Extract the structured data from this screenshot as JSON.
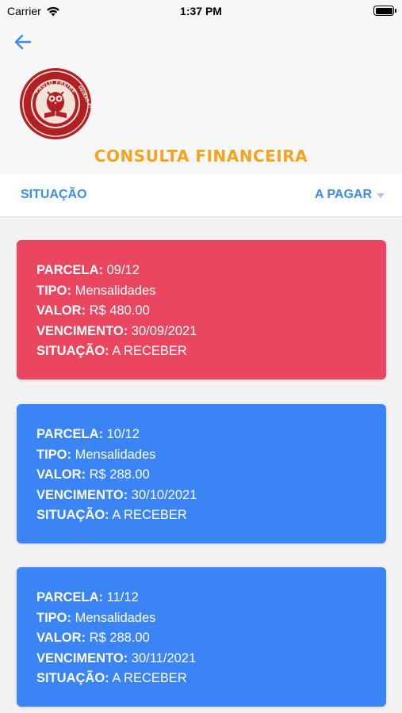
{
  "status_bar": {
    "carrier": "Carrier",
    "time": "1:37 PM",
    "wifi_icon": "wifi-icon",
    "battery_icon": "battery-icon"
  },
  "header": {
    "back_icon": "arrow-left-icon",
    "logo_text_top": "PAULO FREIRE",
    "logo_text_side": "OEIRAS-PI",
    "title": "CONSULTA FINANCEIRA"
  },
  "filter": {
    "label": "SITUAÇÃO",
    "selected": "A PAGAR"
  },
  "cards": [
    {
      "color": "#ea4660",
      "parcela_label": "PARCELA:",
      "parcela": "09/12",
      "tipo_label": "TIPO:",
      "tipo": "Mensalidades",
      "valor_label": "VALOR:",
      "valor": "R$ 480.00",
      "vencimento_label": "VENCIMENTO:",
      "vencimento": "30/09/2021",
      "situacao_label": "SITUAÇÃO:",
      "situacao": "A RECEBER"
    },
    {
      "color": "#3a84f5",
      "parcela_label": "PARCELA:",
      "parcela": "10/12",
      "tipo_label": "TIPO:",
      "tipo": "Mensalidades",
      "valor_label": "VALOR:",
      "valor": "R$ 288.00",
      "vencimento_label": "VENCIMENTO:",
      "vencimento": "30/10/2021",
      "situacao_label": "SITUAÇÃO:",
      "situacao": "A RECEBER"
    },
    {
      "color": "#3a84f5",
      "parcela_label": "PARCELA:",
      "parcela": "11/12",
      "tipo_label": "TIPO:",
      "tipo": "Mensalidades",
      "valor_label": "VALOR:",
      "valor": "R$ 288.00",
      "vencimento_label": "VENCIMENTO:",
      "vencimento": "30/11/2021",
      "situacao_label": "SITUAÇÃO:",
      "situacao": "A RECEBER"
    }
  ]
}
